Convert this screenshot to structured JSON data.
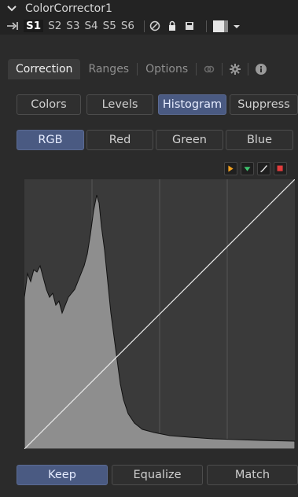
{
  "header": {
    "title": "ColorCorrector1",
    "slots": [
      "S1",
      "S2",
      "S3",
      "S4",
      "S5",
      "S6"
    ],
    "active_slot": "S1"
  },
  "tabs": [
    {
      "label": "Correction",
      "active": true
    },
    {
      "label": "Ranges",
      "active": false
    },
    {
      "label": "Options",
      "active": false
    }
  ],
  "modes": {
    "items": [
      "Colors",
      "Levels",
      "Histogram",
      "Suppress"
    ],
    "selected": "Histogram"
  },
  "channels": {
    "items": [
      "RGB",
      "Red",
      "Green",
      "Blue"
    ],
    "selected": "RGB"
  },
  "histogram_tools": [
    "play-orange-icon",
    "down-arrow-green-icon",
    "curve-icon",
    "stop-red-icon"
  ],
  "bottom": {
    "items": [
      "Keep",
      "Equalize",
      "Match"
    ],
    "selected": "Keep"
  },
  "colors": {
    "accent": "#4a5a82",
    "histogram_fill": "#8e8e8e",
    "panel": "#2b2b2b"
  }
}
